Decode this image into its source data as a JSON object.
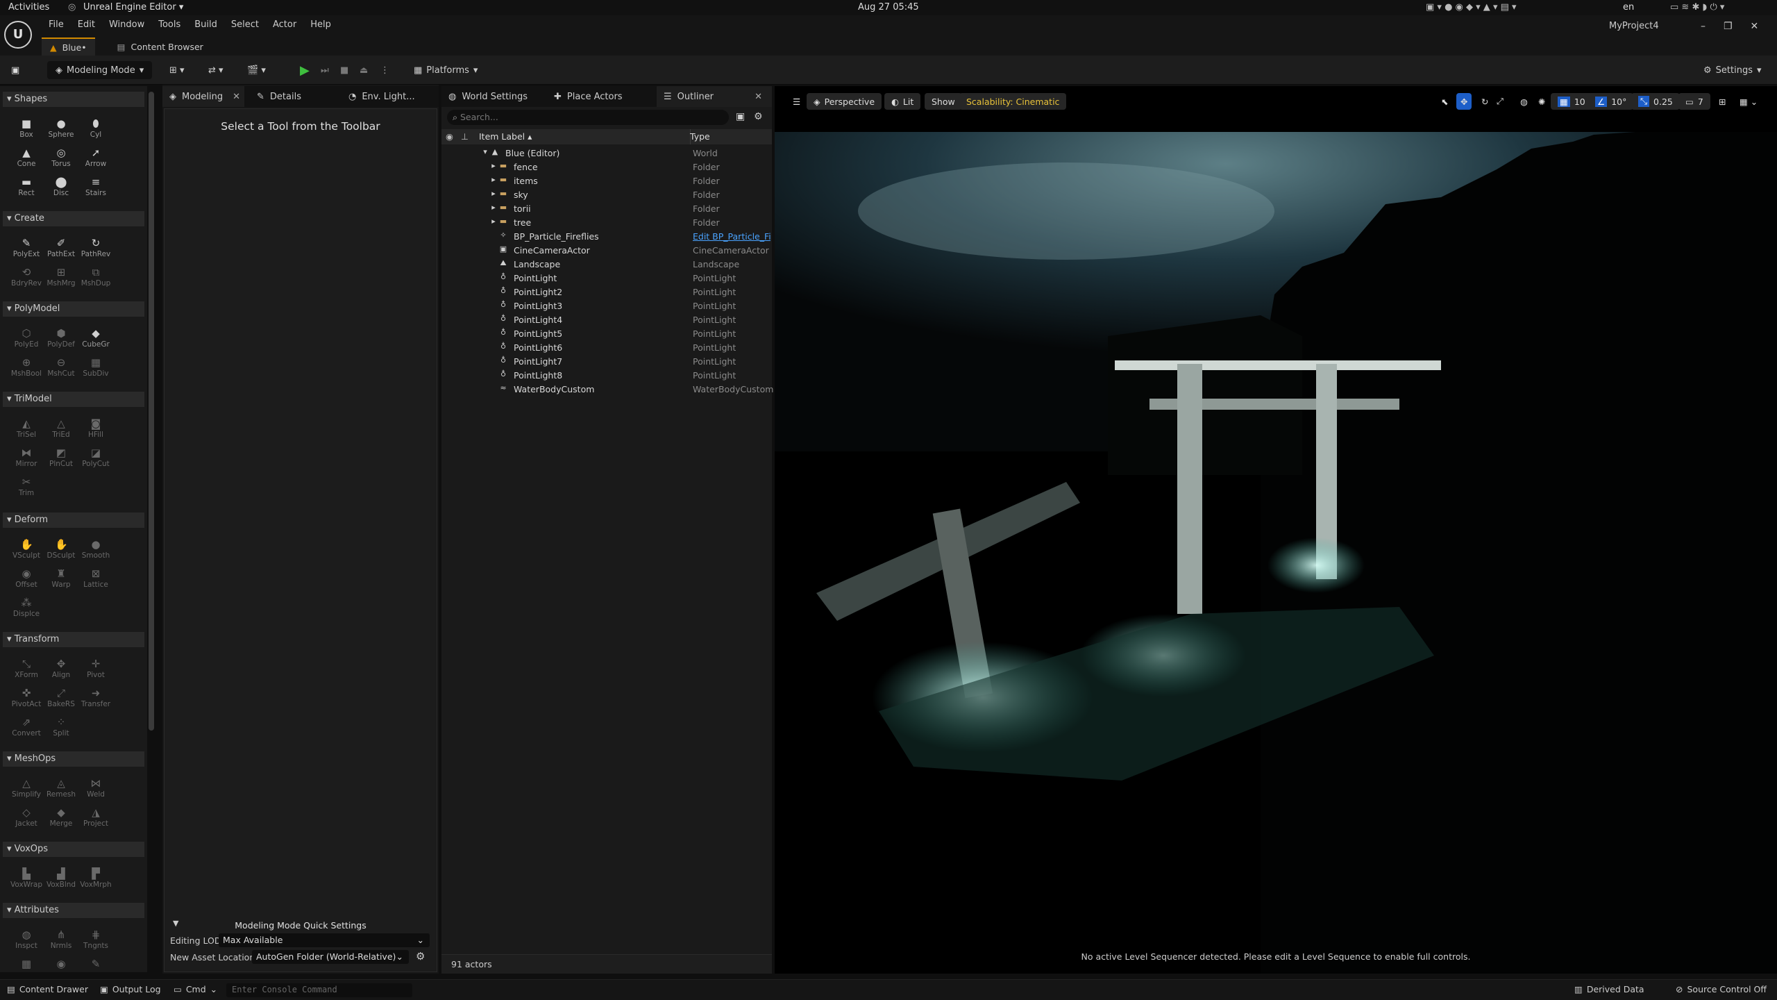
{
  "system_bar": {
    "activities": "Activities",
    "app_menu": "Unreal Engine Editor ▾",
    "clock": "Aug 27  05:45",
    "lang": "en"
  },
  "window": {
    "project_name": "MyProject4",
    "menu": [
      "File",
      "Edit",
      "Window",
      "Tools",
      "Build",
      "Select",
      "Actor",
      "Help"
    ],
    "doc_tabs": {
      "level": "Blue•",
      "content_browser": "Content Browser"
    }
  },
  "toolbar": {
    "mode": "Modeling Mode",
    "platforms": "Platforms",
    "settings": "Settings"
  },
  "palette": {
    "sections": [
      {
        "title": "Shapes",
        "tools": [
          "Box",
          "Sphere",
          "Cyl",
          "Cone",
          "Torus",
          "Arrow",
          "Rect",
          "Disc",
          "Stairs"
        ]
      },
      {
        "title": "Create",
        "tools": [
          "PolyExt",
          "PathExt",
          "PathRev",
          "BdryRev",
          "MshMrg",
          "MshDup"
        ]
      },
      {
        "title": "PolyModel",
        "tools": [
          "PolyEd",
          "PolyDef",
          "CubeGr",
          "MshBool",
          "MshCut",
          "SubDiv"
        ]
      },
      {
        "title": "TriModel",
        "tools": [
          "TriSel",
          "TriEd",
          "HFill",
          "Mirror",
          "PlnCut",
          "PolyCut",
          "Trim"
        ]
      },
      {
        "title": "Deform",
        "tools": [
          "VSculpt",
          "DSculpt",
          "Smooth",
          "Offset",
          "Warp",
          "Lattice",
          "Displce"
        ]
      },
      {
        "title": "Transform",
        "tools": [
          "XForm",
          "Align",
          "Pivot",
          "PivotAct",
          "BakeRS",
          "Transfer",
          "Convert",
          "Split"
        ]
      },
      {
        "title": "MeshOps",
        "tools": [
          "Simplify",
          "Remesh",
          "Weld",
          "Jacket",
          "Merge",
          "Project"
        ]
      },
      {
        "title": "VoxOps",
        "tools": [
          "VoxWrap",
          "VoxBlnd",
          "VoxMrph"
        ]
      },
      {
        "title": "Attributes",
        "tools": [
          "Inspct",
          "Nrmls",
          "Tngnts"
        ]
      }
    ]
  },
  "modeling_panel": {
    "tabs": {
      "modeling": "Modeling",
      "details": "Details",
      "env": "Env. Light..."
    },
    "heading": "Select a Tool from the Toolbar",
    "quick_settings_title": "Modeling Mode Quick Settings",
    "editing_lod_label": "Editing LOD",
    "editing_lod_value": "Max Available",
    "asset_location_label": "New Asset Location",
    "asset_location_value": "AutoGen Folder (World-Relative)"
  },
  "outliner": {
    "tabs": {
      "world_settings": "World Settings",
      "place_actors": "Place Actors",
      "outliner": "Outliner"
    },
    "search_placeholder": "Search...",
    "col_label": "Item Label ▴",
    "col_type": "Type",
    "rows": [
      {
        "label": "Blue (Editor)",
        "type": "World",
        "icon": "world-icon"
      },
      {
        "label": "fence",
        "type": "Folder",
        "icon": "folder-icon"
      },
      {
        "label": "items",
        "type": "Folder",
        "icon": "folder-icon"
      },
      {
        "label": "sky",
        "type": "Folder",
        "icon": "folder-icon"
      },
      {
        "label": "torii",
        "type": "Folder",
        "icon": "folder-icon"
      },
      {
        "label": "tree",
        "type": "Folder",
        "icon": "folder-icon"
      },
      {
        "label": "BP_Particle_Fireflies",
        "type": "Edit BP_Particle_Fir",
        "icon": "blueprint-icon"
      },
      {
        "label": "CineCameraActor",
        "type": "CineCameraActor",
        "icon": "camera-icon"
      },
      {
        "label": "Landscape",
        "type": "Landscape",
        "icon": "landscape-icon"
      },
      {
        "label": "PointLight",
        "type": "PointLight",
        "icon": "bulb-icon"
      },
      {
        "label": "PointLight2",
        "type": "PointLight",
        "icon": "bulb-icon"
      },
      {
        "label": "PointLight3",
        "type": "PointLight",
        "icon": "bulb-icon"
      },
      {
        "label": "PointLight4",
        "type": "PointLight",
        "icon": "bulb-icon"
      },
      {
        "label": "PointLight5",
        "type": "PointLight",
        "icon": "bulb-icon"
      },
      {
        "label": "PointLight6",
        "type": "PointLight",
        "icon": "bulb-icon"
      },
      {
        "label": "PointLight7",
        "type": "PointLight",
        "icon": "bulb-icon"
      },
      {
        "label": "PointLight8",
        "type": "PointLight",
        "icon": "bulb-icon"
      },
      {
        "label": "WaterBodyCustom",
        "type": "WaterBodyCustom",
        "icon": "water-icon"
      }
    ],
    "actor_count": "91 actors"
  },
  "viewport": {
    "perspective": "Perspective",
    "lit": "Lit",
    "show": "Show",
    "scalability": "Scalability: Cinematic",
    "grid_snap": "10",
    "rot_snap": "10°",
    "scale_snap": "0.25",
    "cam_speed": "7",
    "sequencer_msg": "No active Level Sequencer detected. Please edit a Level Sequence to enable full controls."
  },
  "status_bar": {
    "content_drawer": "Content Drawer",
    "output_log": "Output Log",
    "cmd": "Cmd",
    "console_placeholder": "Enter Console Command",
    "derived_data": "Derived Data",
    "source_control": "Source Control Off"
  },
  "colors": {
    "accent": "#d28a00",
    "play_green": "#3fbf3f",
    "link_blue": "#4aa3ff",
    "scalability_yellow": "#e8c23a"
  }
}
